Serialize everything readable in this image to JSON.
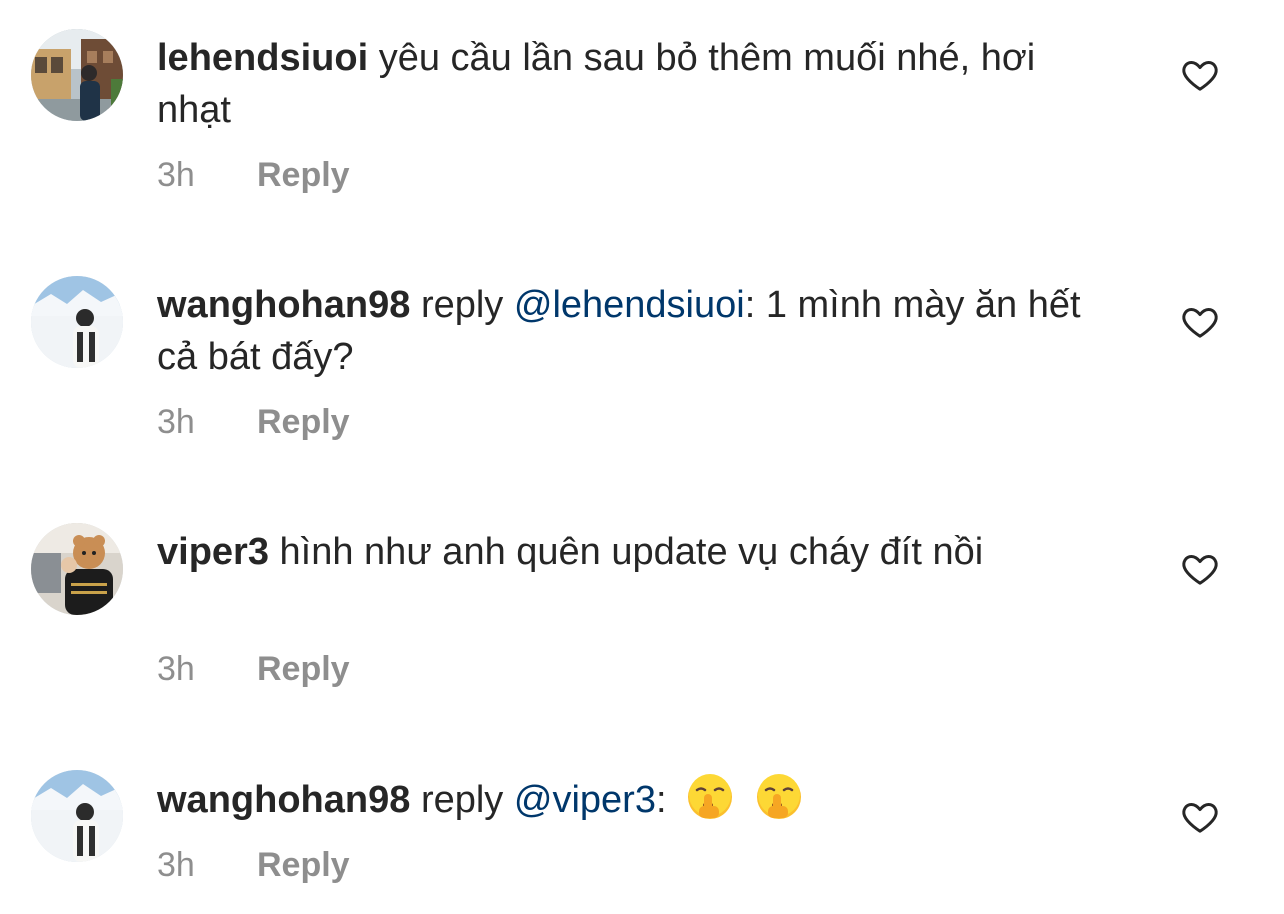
{
  "comments": [
    {
      "username": "lehendsiuoi",
      "reply_prefix": "",
      "mention": "",
      "text": "yêu cầu lần sau bỏ thêm muối nhé, hơi nhạt",
      "time": "3h",
      "reply_label": "Reply",
      "avatar_icon": "profile-photo-street"
    },
    {
      "username": "wanghohan98",
      "reply_prefix": "reply",
      "mention": "@lehendsiuoi",
      "text": ": 1 mình mày ăn hết cả bát đấy?",
      "time": "3h",
      "reply_label": "Reply",
      "avatar_icon": "profile-photo-snow"
    },
    {
      "username": "viper3",
      "reply_prefix": "",
      "mention": "",
      "text": "hình như anh quên update vụ cháy đít nồi",
      "time": "3h",
      "reply_label": "Reply",
      "avatar_icon": "profile-photo-mascot"
    },
    {
      "username": "wanghohan98",
      "reply_prefix": "reply",
      "mention": "@viper3",
      "text": ":",
      "emojis": [
        "shushing-face",
        "shushing-face"
      ],
      "time": "3h",
      "reply_label": "Reply",
      "avatar_icon": "profile-photo-snow"
    }
  ],
  "icons": {
    "like": "heart-outline-icon"
  },
  "colors": {
    "text": "#262626",
    "secondary": "#8e8e8e",
    "mention": "#00376b"
  }
}
